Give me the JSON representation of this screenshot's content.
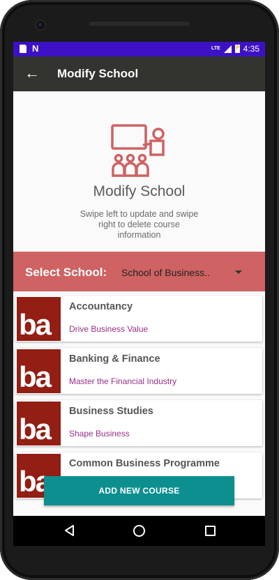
{
  "status_bar": {
    "lte": "LTE",
    "time": "4:35"
  },
  "app_bar": {
    "title": "Modify School"
  },
  "header": {
    "title": "Modify School",
    "subtitle": "Swipe left to update and swipe right to delete course information",
    "icon": "classroom-teacher-icon",
    "accent_color": "#cf6262"
  },
  "select_school": {
    "label": "Select School:",
    "value": "School of Business.."
  },
  "courses": [
    {
      "name": "Accountancy",
      "tagline": "Drive Business Value",
      "logo_text": "ba"
    },
    {
      "name": "Banking & Finance",
      "tagline": "Master the Financial Industry",
      "logo_text": "ba"
    },
    {
      "name": "Business Studies",
      "tagline": "Shape Business",
      "logo_text": "ba"
    },
    {
      "name": "Common Business Programme",
      "tagline": "",
      "logo_text": "ba"
    }
  ],
  "actions": {
    "add_course_label": "ADD NEW COURSE",
    "button_color": "#0e8f8f"
  }
}
